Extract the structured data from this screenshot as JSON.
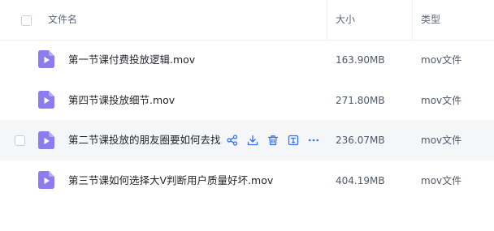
{
  "header": {
    "name_label": "文件名",
    "size_label": "大小",
    "type_label": "类型"
  },
  "files": [
    {
      "name": "第一节课付费投放逻辑.mov",
      "size": "163.90MB",
      "type": "mov文件"
    },
    {
      "name": "第四节课投放细节.mov",
      "size": "271.80MB",
      "type": "mov文件"
    },
    {
      "name": "第二节课投放的朋友圈要如何去找.mov",
      "size": "236.07MB",
      "type": "mov文件"
    },
    {
      "name": "第三节课如何选择大V判断用户质量好坏.mov",
      "size": "404.19MB",
      "type": "mov文件"
    }
  ],
  "hovered_row_index": 2,
  "row_actions": [
    "share-icon",
    "download-icon",
    "delete-icon",
    "rename-icon",
    "more-icon"
  ],
  "colors": {
    "accent": "#3370ff",
    "file_icon": "#8c7cf0",
    "hover_bg": "#f5f6f8"
  }
}
